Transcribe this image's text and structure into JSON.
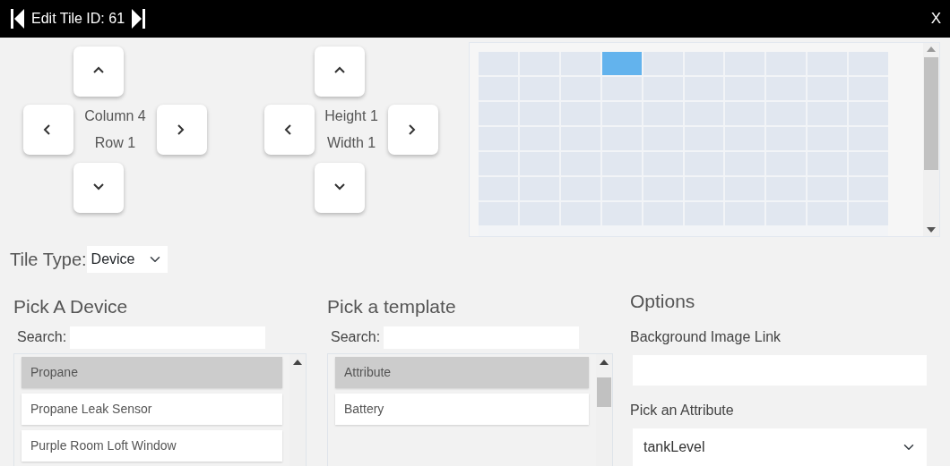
{
  "header": {
    "title": "Edit Tile ID: 61",
    "close": "X"
  },
  "position": {
    "column": "Column 4",
    "row": "Row 1"
  },
  "size": {
    "height": "Height 1",
    "width": "Width 1"
  },
  "placement_grid": {
    "rows": [
      [
        {
          "selected": false
        },
        {
          "selected": false
        },
        {
          "selected": false
        },
        {
          "selected": true
        },
        {
          "selected": false
        },
        {
          "selected": false
        },
        {
          "selected": false
        },
        {
          "selected": false
        },
        {
          "selected": false
        },
        {
          "selected": false
        }
      ],
      [
        {
          "selected": false
        },
        {
          "selected": false
        },
        {
          "selected": false
        },
        {
          "selected": false
        },
        {
          "selected": false
        },
        {
          "selected": false
        },
        {
          "selected": false
        },
        {
          "selected": false
        },
        {
          "selected": false
        },
        {
          "selected": false
        }
      ],
      [
        {
          "selected": false
        },
        {
          "selected": false
        },
        {
          "selected": false
        },
        {
          "selected": false
        },
        {
          "selected": false
        },
        {
          "selected": false
        },
        {
          "selected": false
        },
        {
          "selected": false
        },
        {
          "selected": false
        },
        {
          "selected": false
        }
      ],
      [
        {
          "selected": false
        },
        {
          "selected": false
        },
        {
          "selected": false
        },
        {
          "selected": false
        },
        {
          "selected": false
        },
        {
          "selected": false
        },
        {
          "selected": false
        },
        {
          "selected": false
        },
        {
          "selected": false
        },
        {
          "selected": false
        }
      ],
      [
        {
          "selected": false
        },
        {
          "selected": false
        },
        {
          "selected": false
        },
        {
          "selected": false
        },
        {
          "selected": false
        },
        {
          "selected": false
        },
        {
          "selected": false
        },
        {
          "selected": false
        },
        {
          "selected": false
        },
        {
          "selected": false
        }
      ],
      [
        {
          "selected": false
        },
        {
          "selected": false
        },
        {
          "selected": false
        },
        {
          "selected": false
        },
        {
          "selected": false
        },
        {
          "selected": false
        },
        {
          "selected": false
        },
        {
          "selected": false
        },
        {
          "selected": false
        },
        {
          "selected": false
        }
      ],
      [
        {
          "selected": false
        },
        {
          "selected": false
        },
        {
          "selected": false
        },
        {
          "selected": false
        },
        {
          "selected": false
        },
        {
          "selected": false
        },
        {
          "selected": false
        },
        {
          "selected": false
        },
        {
          "selected": false
        },
        {
          "selected": false
        }
      ]
    ]
  },
  "tile_type": {
    "label": "Tile Type:",
    "value": "Device"
  },
  "device_picker": {
    "title": "Pick A Device",
    "search_label": "Search:",
    "items": [
      {
        "label": "Propane",
        "selected": true
      },
      {
        "label": "Propane Leak Sensor",
        "selected": false
      },
      {
        "label": "Purple Room Loft Window",
        "selected": false
      }
    ]
  },
  "template_picker": {
    "title": "Pick a template",
    "search_label": "Search:",
    "items": [
      {
        "label": "Attribute",
        "selected": true
      },
      {
        "label": "Battery",
        "selected": false
      }
    ]
  },
  "options": {
    "title": "Options",
    "background_label": "Background Image Link",
    "attribute_label": "Pick an Attribute",
    "attribute_value": "tankLevel"
  }
}
